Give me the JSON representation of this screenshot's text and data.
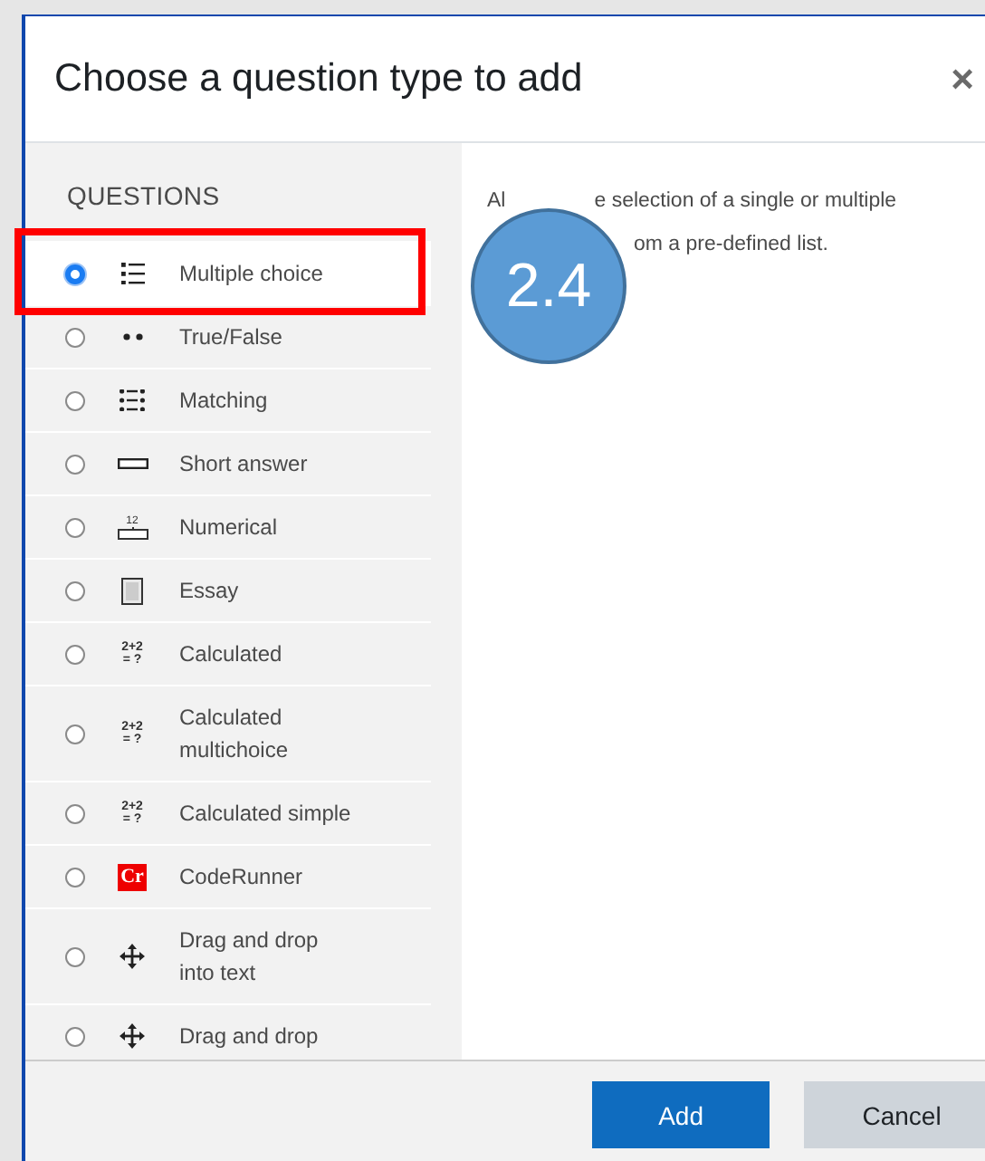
{
  "dialog": {
    "title": "Choose a question type to add",
    "close": "×"
  },
  "sidebar": {
    "heading": "QUESTIONS",
    "items": [
      {
        "label": "Multiple choice",
        "kind": "list",
        "selected": true
      },
      {
        "label": "True/False",
        "kind": "dots",
        "selected": false
      },
      {
        "label": "Matching",
        "kind": "matching",
        "selected": false
      },
      {
        "label": "Short answer",
        "kind": "field",
        "selected": false
      },
      {
        "label": "Numerical",
        "kind": "numeric",
        "icon_text": "12",
        "selected": false
      },
      {
        "label": "Essay",
        "kind": "page",
        "selected": false
      },
      {
        "label": "Calculated",
        "kind": "formula",
        "icon_text": "2+2",
        "icon_text_2": "= ?",
        "selected": false
      },
      {
        "label": "Calculated\nmultichoice",
        "kind": "formula",
        "icon_text": "2+2",
        "icon_text_2": "= ?",
        "selected": false
      },
      {
        "label": "Calculated simple",
        "kind": "formula",
        "icon_text": "2+2",
        "icon_text_2": "= ?",
        "selected": false
      },
      {
        "label": "CodeRunner",
        "kind": "badge",
        "icon_text": "Cr",
        "selected": false
      },
      {
        "label": "Drag and drop\ninto text",
        "kind": "move",
        "selected": false
      },
      {
        "label": "Drag and drop",
        "kind": "move",
        "selected": false
      }
    ]
  },
  "description": {
    "line_1_start": "Al",
    "line_1_end": "e selection of a single or multiple",
    "line_2_end": "om a pre-defined list."
  },
  "annotation": {
    "label": "2.4"
  },
  "buttons": [
    {
      "label": "Add",
      "kind": "primary"
    },
    {
      "label": "Cancel",
      "kind": "secondary"
    }
  ]
}
